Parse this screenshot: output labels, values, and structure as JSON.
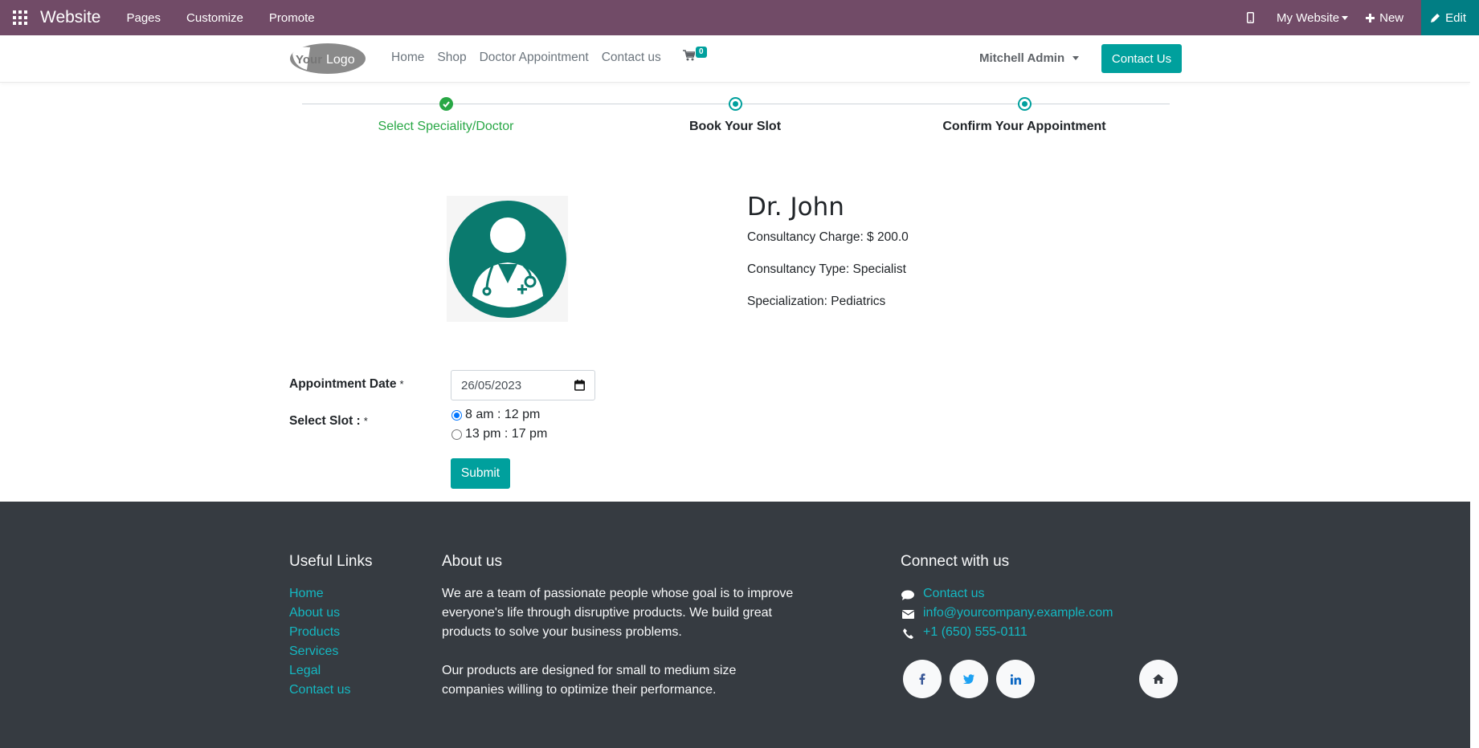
{
  "admin_bar": {
    "brand": "Website",
    "menu": [
      "Pages",
      "Customize",
      "Promote"
    ],
    "website_selector": "My Website",
    "new_label": "New",
    "edit_label": "Edit",
    "color": "#714b67"
  },
  "header": {
    "logo_text": "YourLogo",
    "nav": [
      "Home",
      "Shop",
      "Doctor Appointment",
      "Contact us"
    ],
    "cart_count": "0",
    "user": "Mitchell Admin",
    "cta": "Contact Us",
    "accent": "#00a09d"
  },
  "steps": [
    {
      "label": "Select Speciality/Doctor",
      "state": "done"
    },
    {
      "label": "Book Your Slot",
      "state": "active"
    },
    {
      "label": "Confirm Your Appointment",
      "state": "active"
    }
  ],
  "doctor": {
    "name": "Dr. John",
    "charge": "Consultancy Charge: $ 200.0",
    "type": "Consultancy Type: Specialist",
    "specialization": "Specialization: Pediatrics"
  },
  "form": {
    "date_label": "Appointment Date",
    "date_value": "26/05/2023",
    "slot_label": "Select Slot :",
    "required_mark": "*",
    "slots": [
      {
        "label": "8 am : 12 pm",
        "checked": true
      },
      {
        "label": "13 pm : 17 pm",
        "checked": false
      }
    ],
    "submit": "Submit"
  },
  "footer": {
    "useful_links_title": "Useful Links",
    "useful_links": [
      "Home",
      "About us",
      "Products",
      "Services",
      "Legal",
      "Contact us"
    ],
    "about_title": "About us",
    "about_lines_1": [
      "We are a team of passionate people whose goal is to improve",
      "everyone's life through disruptive products. We build great",
      "products to solve your business problems."
    ],
    "about_lines_2": [
      "Our products are designed for small to medium size",
      "companies willing to optimize their performance."
    ],
    "connect_title": "Connect with us",
    "connect": {
      "contact": "Contact us",
      "email": "info@yourcompany.example.com",
      "phone": "+1 (650) 555-0111"
    },
    "social_icons": [
      "facebook-icon",
      "twitter-icon",
      "linkedin-icon",
      "home-icon"
    ]
  }
}
